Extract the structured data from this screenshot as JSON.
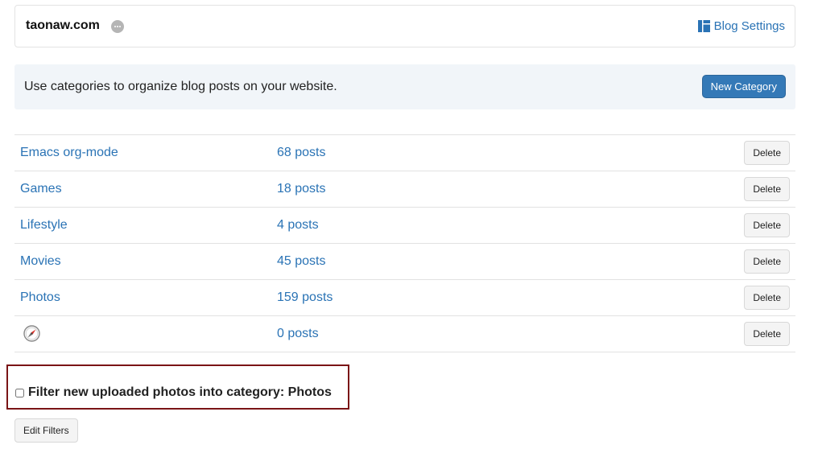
{
  "header": {
    "site_name": "taonaw.com",
    "more_icon": "ellipsis-circle-icon",
    "blog_settings_label": "Blog Settings",
    "blog_settings_icon": "layout-icon"
  },
  "banner": {
    "text": "Use categories to organize blog posts on your website.",
    "new_category_label": "New Category"
  },
  "categories": [
    {
      "name": "Emacs org-mode",
      "count": "68 posts",
      "delete_label": "Delete"
    },
    {
      "name": "Games",
      "count": "18 posts",
      "delete_label": "Delete"
    },
    {
      "name": "Lifestyle",
      "count": "4 posts",
      "delete_label": "Delete"
    },
    {
      "name": "Movies",
      "count": "45 posts",
      "delete_label": "Delete"
    },
    {
      "name": "Photos",
      "count": "159 posts",
      "delete_label": "Delete"
    },
    {
      "name": "",
      "icon": "compass-icon",
      "count": "0 posts",
      "delete_label": "Delete"
    }
  ],
  "filter": {
    "checked": false,
    "label": "Filter new uploaded photos into category: Photos",
    "edit_filters_label": "Edit Filters"
  },
  "colors": {
    "link": "#2a73b5",
    "primary_button": "#3479b7",
    "banner_bg": "#f1f5f9",
    "highlight_border": "#7a1416"
  }
}
